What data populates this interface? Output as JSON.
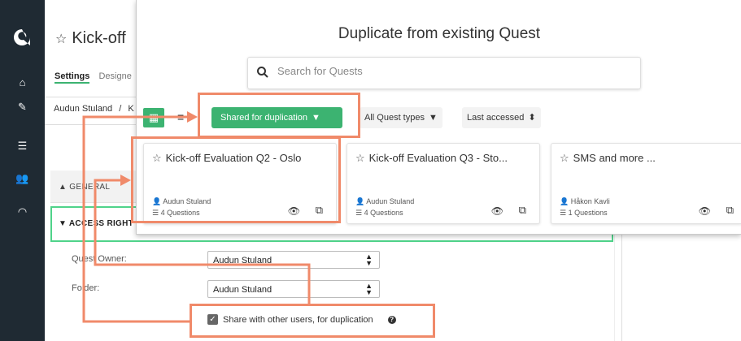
{
  "sidebar": {
    "icons": [
      "logo-icon",
      "home-icon",
      "edit-icon",
      "list-icon",
      "users-icon",
      "gauge-icon"
    ]
  },
  "page": {
    "title": "Kick-off",
    "tabs": [
      "Settings",
      "Designe"
    ],
    "breadcrumb": "Audun Stuland",
    "breadcrumb_sep": "/",
    "breadcrumb_tail": "K",
    "sections": {
      "general": "GENERAL",
      "access_rights": "ACCESS RIGHT"
    },
    "form": {
      "owner_label": "Quest Owner:",
      "owner_value": "Audun Stuland",
      "folder_label": "Folder:",
      "folder_value": "Audun Stuland",
      "share_label": "Share with other users, for duplication",
      "share_checked": true
    }
  },
  "modal": {
    "title": "Duplicate from existing Quest",
    "search_placeholder": "Search for Quests",
    "filters": {
      "shared": "Shared for duplication",
      "types": "All Quest types",
      "sort": "Last accessed"
    },
    "cards": [
      {
        "title": "Kick-off Evaluation Q2 - Oslo",
        "owner": "Audun Stuland",
        "count": "4 Questions"
      },
      {
        "title": "Kick-off Evaluation Q3 - Sto...",
        "owner": "Audun Stuland",
        "count": "4 Questions"
      },
      {
        "title": "SMS and more ...",
        "owner": "Håkon Kavli",
        "count": "1 Questions"
      }
    ]
  },
  "colors": {
    "accent": "#3cb371",
    "sidebar": "#1f2a33",
    "annotation": "#f08a6a"
  }
}
